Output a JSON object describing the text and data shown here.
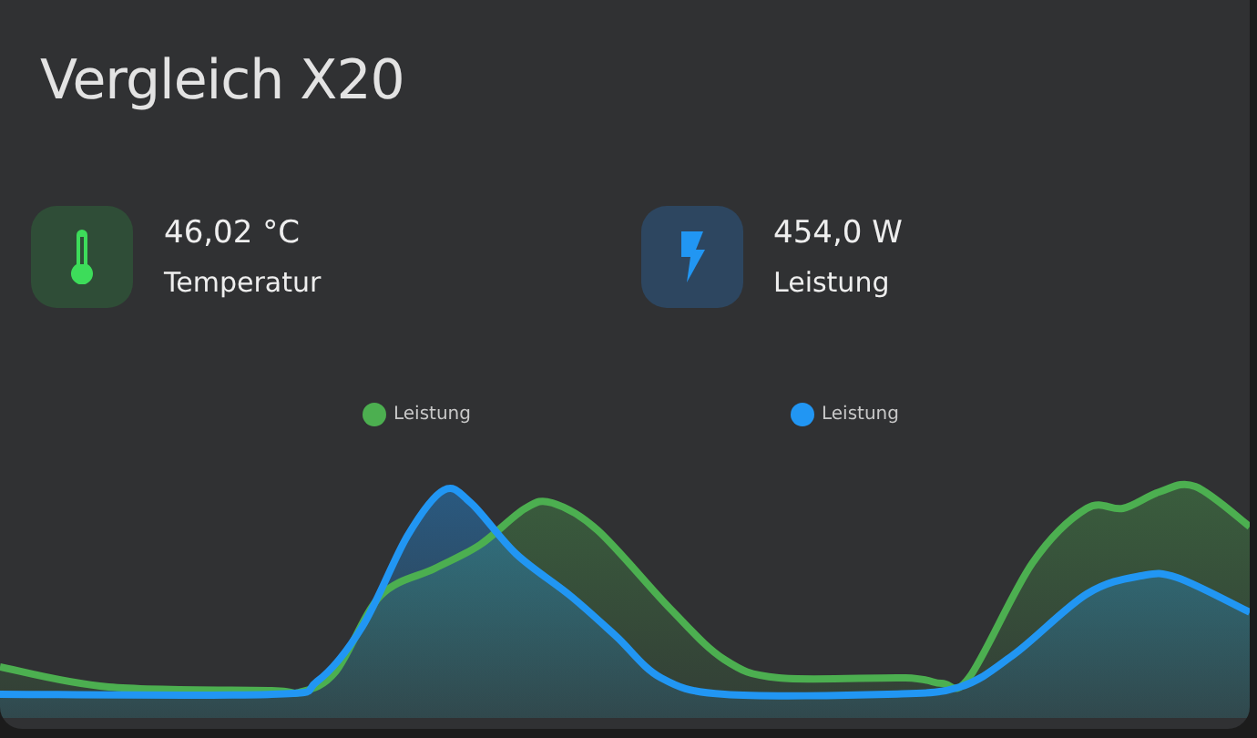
{
  "card": {
    "title": "Vergleich X20",
    "entities": [
      {
        "kind": "temperature",
        "value": "46,02 °C",
        "name": "Temperatur"
      },
      {
        "kind": "power",
        "value": "454,0 W",
        "name": "Leistung"
      }
    ],
    "legend": [
      {
        "label": "Leistung",
        "color": "#4caf50"
      },
      {
        "label": "Leistung",
        "color": "#2196f3"
      }
    ]
  }
}
